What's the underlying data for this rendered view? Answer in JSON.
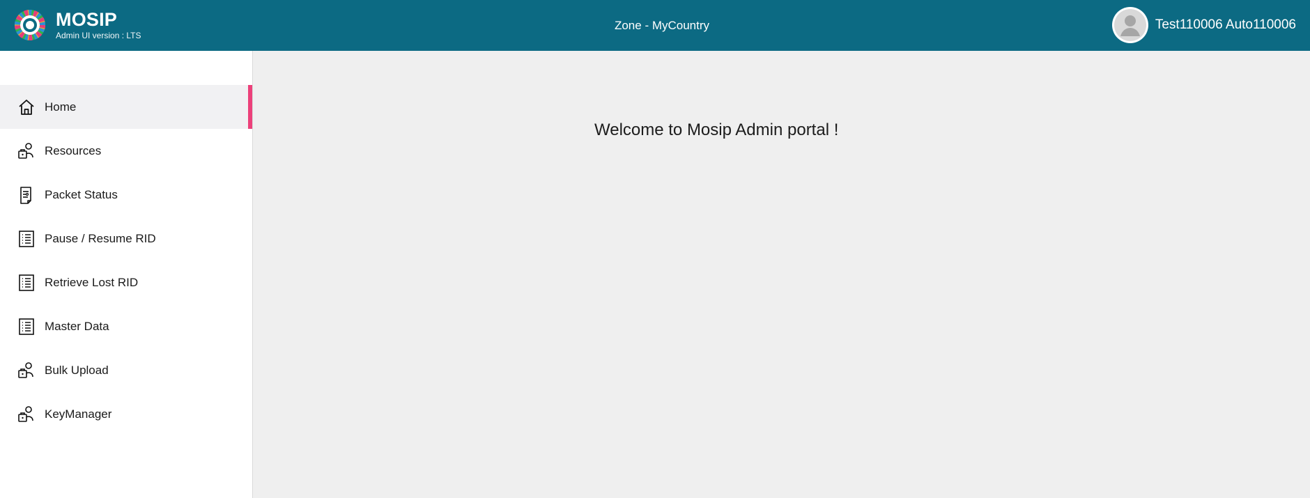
{
  "header": {
    "brand_title": "MOSIP",
    "brand_subtitle": "Admin UI version : LTS",
    "zone_label": "Zone - MyCountry",
    "user_name": "Test110006 Auto110006",
    "background_color": "#0c6a83"
  },
  "sidebar": {
    "items": [
      {
        "label": "Home",
        "icon": "home-icon",
        "active": true
      },
      {
        "label": "Resources",
        "icon": "resources-icon",
        "active": false
      },
      {
        "label": "Packet Status",
        "icon": "packet-status-icon",
        "active": false
      },
      {
        "label": "Pause / Resume RID",
        "icon": "list-icon",
        "active": false
      },
      {
        "label": "Retrieve Lost RID",
        "icon": "list-icon",
        "active": false
      },
      {
        "label": "Master Data",
        "icon": "list-icon",
        "active": false
      },
      {
        "label": "Bulk Upload",
        "icon": "upload-user-icon",
        "active": false
      },
      {
        "label": "KeyManager",
        "icon": "key-manager-icon",
        "active": false
      }
    ],
    "active_indicator_color": "#ec407a"
  },
  "main": {
    "welcome_text": "Welcome to Mosip Admin portal !"
  }
}
